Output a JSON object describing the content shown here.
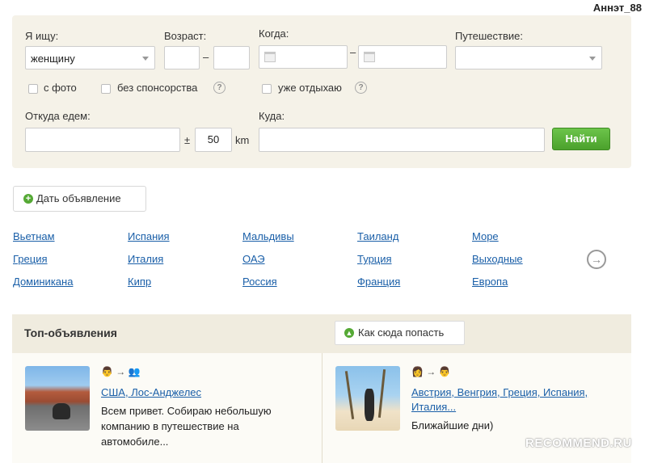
{
  "user": {
    "name": "Аннэт_88"
  },
  "search": {
    "seeking_label": "Я ищу:",
    "seeking_value": "женщину",
    "age_label": "Возраст:",
    "age_from": "",
    "age_to": "",
    "age_dash": "–",
    "when_label": "Когда:",
    "date_dash": "–",
    "trip_label": "Путешествие:",
    "trip_value": "",
    "with_photo_label": "с фото",
    "no_sponsor_label": "без спонсорства",
    "already_resting_label": "уже отдыхаю",
    "help_glyph": "?",
    "from_label": "Откуда едем:",
    "from_value": "",
    "radius_sign": "±",
    "radius_value": "50",
    "radius_unit": "km",
    "to_label": "Куда:",
    "to_value": "",
    "find_button": "Найти"
  },
  "post_ad_button": "Дать объявление",
  "destinations": [
    "Вьетнам",
    "Испания",
    "Мальдивы",
    "Таиланд",
    "Море",
    "Греция",
    "Италия",
    "ОАЭ",
    "Турция",
    "Выходные",
    "Доминикана",
    "Кипр",
    "Россия",
    "Франция",
    "Европа"
  ],
  "top_ads": {
    "title": "Топ-объявления",
    "how_button": "Как сюда попасть",
    "cards": [
      {
        "destination": "США, Лос-Анджелес",
        "text_line1": "Всем привет. Собираю небольшую",
        "text_line2": "компанию в путешествие на",
        "text_line3": "автомобиле..."
      },
      {
        "destination_line1": "Австрия, Венгрия, Греция, Испания,",
        "destination_line2": "Италия...",
        "text_line1": "Ближайшие дни)"
      }
    ]
  },
  "watermark": "RECOMMEND.RU",
  "colors": {
    "panel": "#f5f2e8",
    "link": "#1a5fa8",
    "find_button": "#55a935"
  }
}
